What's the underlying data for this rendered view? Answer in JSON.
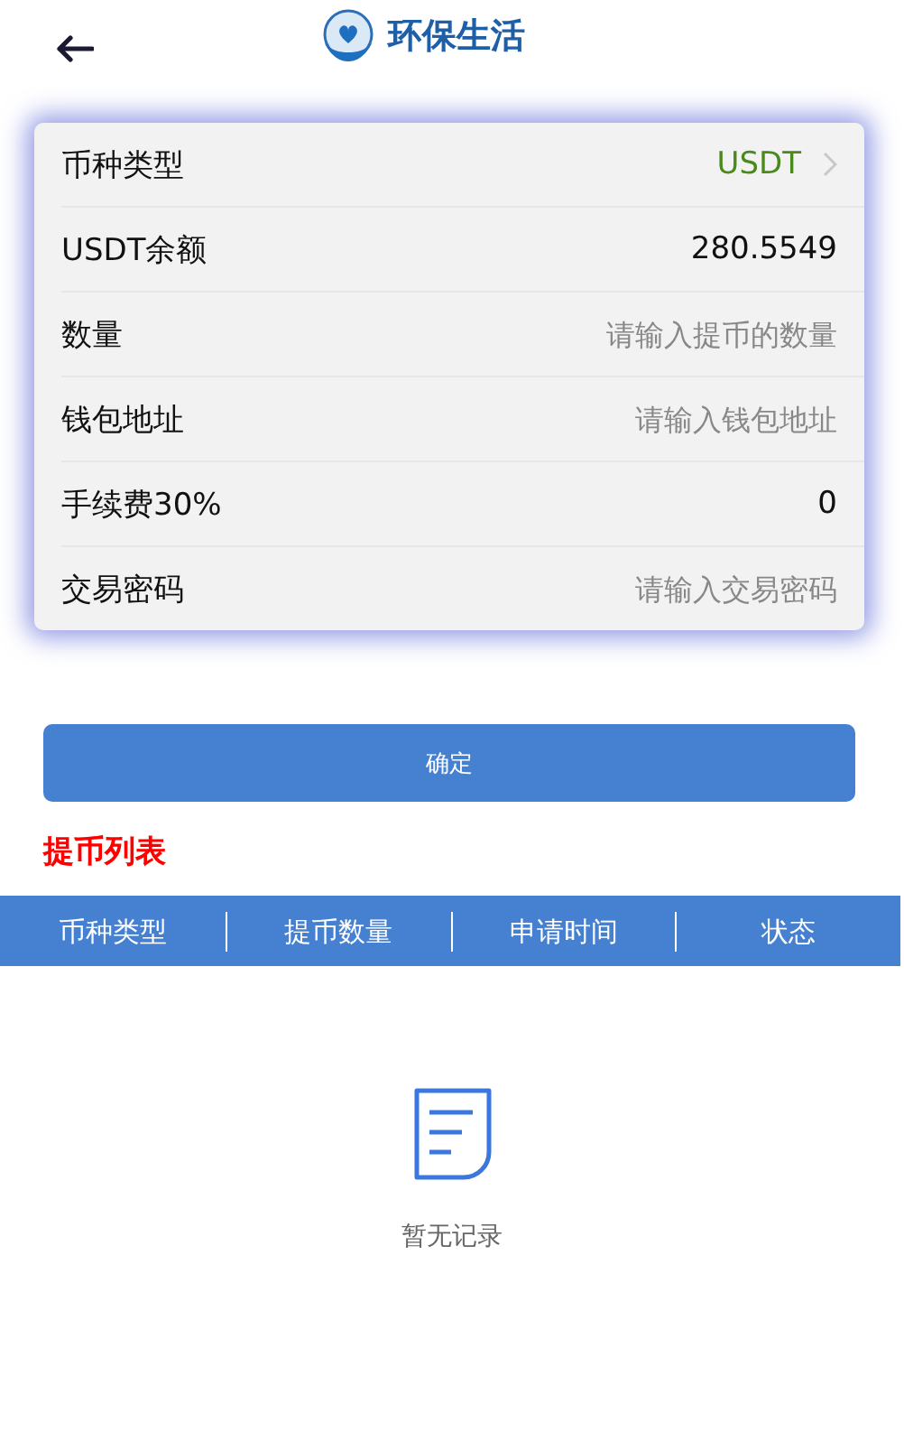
{
  "header": {
    "title": "环保生活"
  },
  "form": {
    "rows": [
      {
        "kind": "select",
        "label": "币种类型",
        "value": "USDT"
      },
      {
        "kind": "value",
        "label": "USDT余额",
        "value": "280.5549"
      },
      {
        "kind": "input",
        "label": "数量",
        "placeholder": "请输入提币的数量"
      },
      {
        "kind": "input",
        "label": "钱包地址",
        "placeholder": "请输入钱包地址"
      },
      {
        "kind": "value",
        "label": "手续费30%",
        "value": "0"
      },
      {
        "kind": "input",
        "label": "交易密码",
        "placeholder": "请输入交易密码"
      }
    ]
  },
  "confirm_button": "确定",
  "list_title": "提币列表",
  "table": {
    "columns": [
      "币种类型",
      "提币数量",
      "申请时间",
      "状态"
    ]
  },
  "empty_state": "暂无记录"
}
